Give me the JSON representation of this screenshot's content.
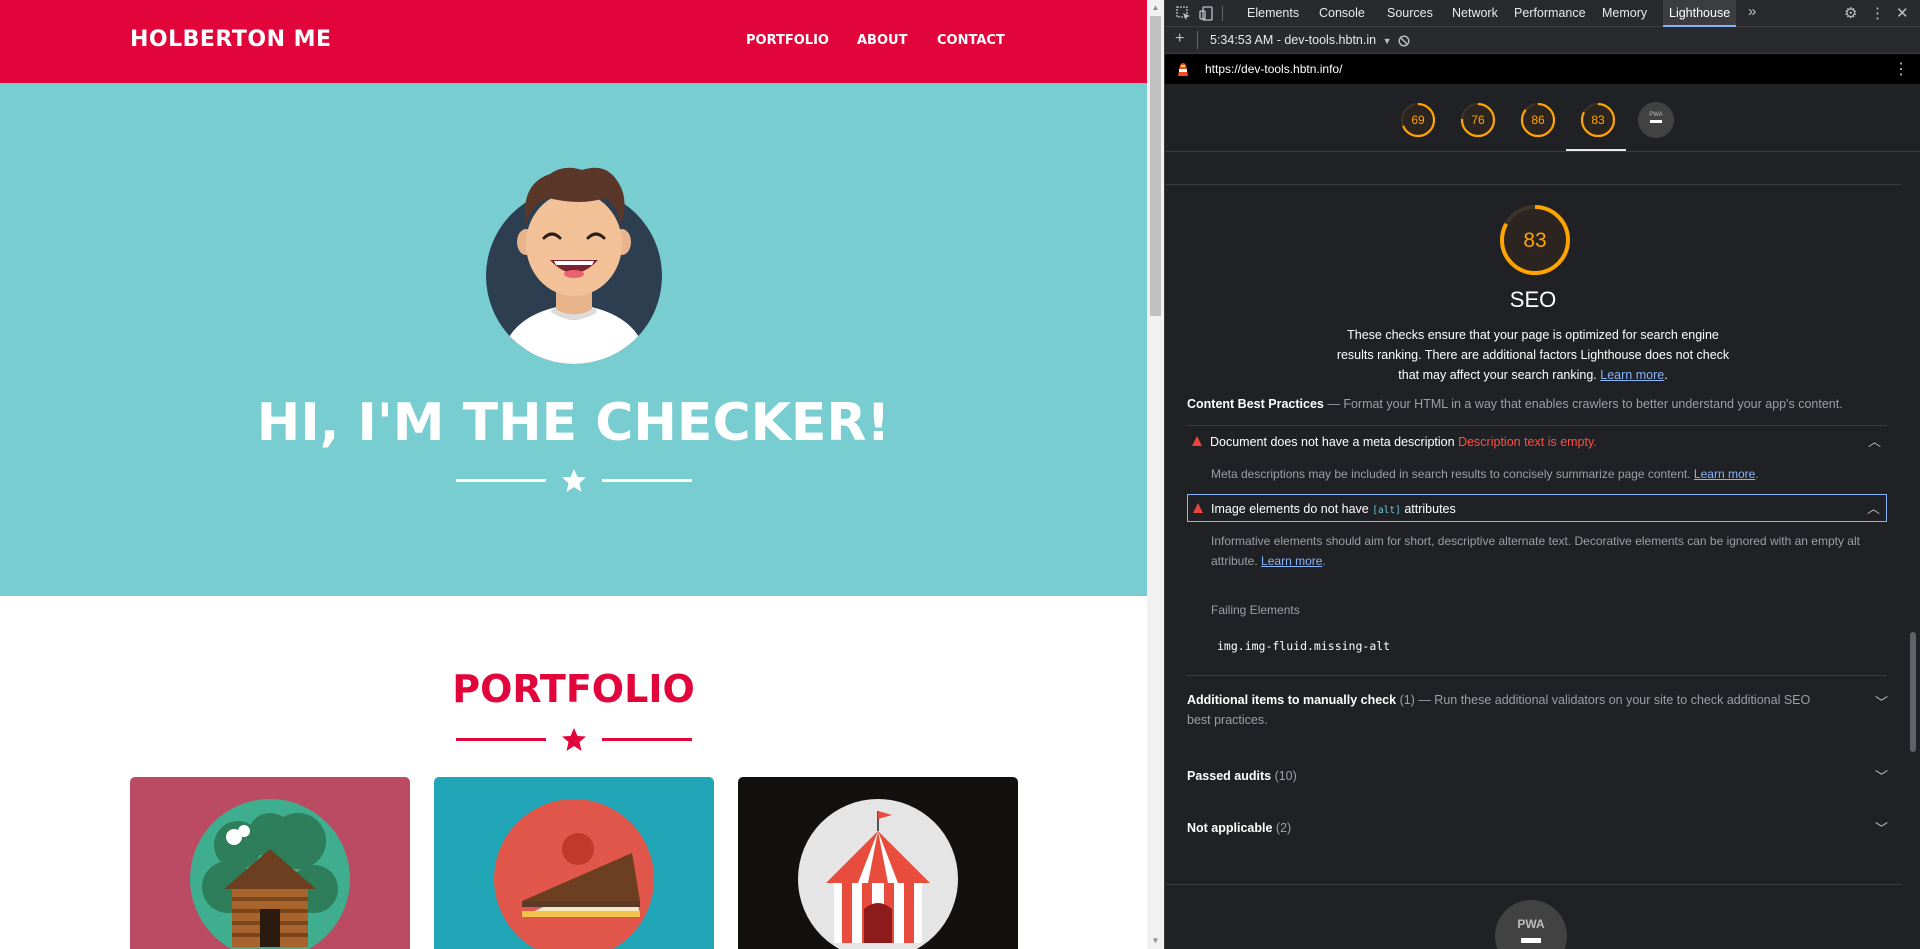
{
  "site": {
    "brand": "HOLBERTON ME",
    "nav": [
      "PORTFOLIO",
      "ABOUT",
      "CONTACT"
    ],
    "hero_title": "HI, I'M THE CHECKER!",
    "portfolio_title": "PORTFOLIO",
    "colors": {
      "primary": "#e1053b",
      "hero_bg": "#78cdd1"
    },
    "cards": [
      {
        "icon": "cabin-icon",
        "bg": "#bb4b63"
      },
      {
        "icon": "cake-icon",
        "bg": "#21a6b8"
      },
      {
        "icon": "circus-tent-icon",
        "bg": "#131010"
      }
    ]
  },
  "devtools": {
    "tabs": [
      "Elements",
      "Console",
      "Sources",
      "Network",
      "Performance",
      "Memory",
      "Lighthouse"
    ],
    "active_tab": "Lighthouse",
    "more_tabs": "»",
    "report_selector": "5:34:53 AM - dev-tools.hbtn.in",
    "url": "https://dev-tools.hbtn.info/",
    "scores": [
      {
        "value": 69,
        "color": "#ffa400"
      },
      {
        "value": 76,
        "color": "#ffa400"
      },
      {
        "value": 86,
        "color": "#ffa400"
      },
      {
        "value": 83,
        "color": "#ffa400"
      }
    ],
    "pwa_label": "PWA",
    "seo": {
      "score": 83,
      "title": "SEO",
      "description": "These checks ensure that your page is optimized for search engine results ranking. There are additional factors Lighthouse does not check that may affect your search ranking.",
      "learn_more": "Learn more",
      "content_best_practices": {
        "title": "Content Best Practices",
        "subtitle": "— Format your HTML in a way that enables crawlers to better understand your app's content."
      },
      "audits": [
        {
          "title": "Document does not have a meta description",
          "error": "Description text is empty.",
          "description": "Meta descriptions may be included in search results to concisely summarize page content.",
          "learn_more": "Learn more"
        },
        {
          "title_pre": "Image elements do not have",
          "code": "[alt]",
          "title_post": "attributes",
          "description": "Informative elements should aim for short, descriptive alternate text. Decorative elements can be ignored with an empty alt attribute.",
          "learn_more": "Learn more",
          "failing_label": "Failing Elements",
          "failing_selector": "img.img-fluid.missing-alt"
        }
      ],
      "manual": {
        "title": "Additional items to manually check",
        "count": "(1)",
        "subtitle": "— Run these additional validators on your site to check additional SEO best practices."
      },
      "passed": {
        "title": "Passed audits",
        "count": "(10)"
      },
      "not_applicable": {
        "title": "Not applicable",
        "count": "(2)"
      }
    }
  }
}
